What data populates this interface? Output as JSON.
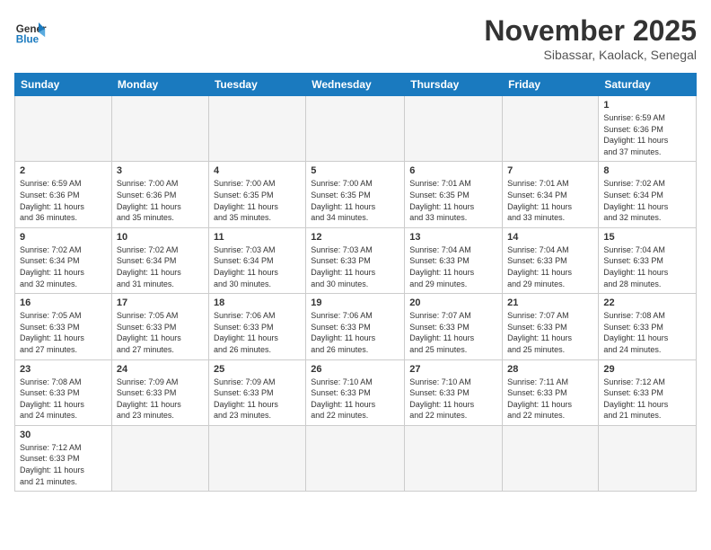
{
  "header": {
    "logo_general": "General",
    "logo_blue": "Blue",
    "month_title": "November 2025",
    "location": "Sibassar, Kaolack, Senegal"
  },
  "days_of_week": [
    "Sunday",
    "Monday",
    "Tuesday",
    "Wednesday",
    "Thursday",
    "Friday",
    "Saturday"
  ],
  "weeks": [
    [
      {
        "day": "",
        "info": ""
      },
      {
        "day": "",
        "info": ""
      },
      {
        "day": "",
        "info": ""
      },
      {
        "day": "",
        "info": ""
      },
      {
        "day": "",
        "info": ""
      },
      {
        "day": "",
        "info": ""
      },
      {
        "day": "1",
        "info": "Sunrise: 6:59 AM\nSunset: 6:36 PM\nDaylight: 11 hours\nand 37 minutes."
      }
    ],
    [
      {
        "day": "2",
        "info": "Sunrise: 6:59 AM\nSunset: 6:36 PM\nDaylight: 11 hours\nand 36 minutes."
      },
      {
        "day": "3",
        "info": "Sunrise: 7:00 AM\nSunset: 6:36 PM\nDaylight: 11 hours\nand 35 minutes."
      },
      {
        "day": "4",
        "info": "Sunrise: 7:00 AM\nSunset: 6:35 PM\nDaylight: 11 hours\nand 35 minutes."
      },
      {
        "day": "5",
        "info": "Sunrise: 7:00 AM\nSunset: 6:35 PM\nDaylight: 11 hours\nand 34 minutes."
      },
      {
        "day": "6",
        "info": "Sunrise: 7:01 AM\nSunset: 6:35 PM\nDaylight: 11 hours\nand 33 minutes."
      },
      {
        "day": "7",
        "info": "Sunrise: 7:01 AM\nSunset: 6:34 PM\nDaylight: 11 hours\nand 33 minutes."
      },
      {
        "day": "8",
        "info": "Sunrise: 7:02 AM\nSunset: 6:34 PM\nDaylight: 11 hours\nand 32 minutes."
      }
    ],
    [
      {
        "day": "9",
        "info": "Sunrise: 7:02 AM\nSunset: 6:34 PM\nDaylight: 11 hours\nand 32 minutes."
      },
      {
        "day": "10",
        "info": "Sunrise: 7:02 AM\nSunset: 6:34 PM\nDaylight: 11 hours\nand 31 minutes."
      },
      {
        "day": "11",
        "info": "Sunrise: 7:03 AM\nSunset: 6:34 PM\nDaylight: 11 hours\nand 30 minutes."
      },
      {
        "day": "12",
        "info": "Sunrise: 7:03 AM\nSunset: 6:33 PM\nDaylight: 11 hours\nand 30 minutes."
      },
      {
        "day": "13",
        "info": "Sunrise: 7:04 AM\nSunset: 6:33 PM\nDaylight: 11 hours\nand 29 minutes."
      },
      {
        "day": "14",
        "info": "Sunrise: 7:04 AM\nSunset: 6:33 PM\nDaylight: 11 hours\nand 29 minutes."
      },
      {
        "day": "15",
        "info": "Sunrise: 7:04 AM\nSunset: 6:33 PM\nDaylight: 11 hours\nand 28 minutes."
      }
    ],
    [
      {
        "day": "16",
        "info": "Sunrise: 7:05 AM\nSunset: 6:33 PM\nDaylight: 11 hours\nand 27 minutes."
      },
      {
        "day": "17",
        "info": "Sunrise: 7:05 AM\nSunset: 6:33 PM\nDaylight: 11 hours\nand 27 minutes."
      },
      {
        "day": "18",
        "info": "Sunrise: 7:06 AM\nSunset: 6:33 PM\nDaylight: 11 hours\nand 26 minutes."
      },
      {
        "day": "19",
        "info": "Sunrise: 7:06 AM\nSunset: 6:33 PM\nDaylight: 11 hours\nand 26 minutes."
      },
      {
        "day": "20",
        "info": "Sunrise: 7:07 AM\nSunset: 6:33 PM\nDaylight: 11 hours\nand 25 minutes."
      },
      {
        "day": "21",
        "info": "Sunrise: 7:07 AM\nSunset: 6:33 PM\nDaylight: 11 hours\nand 25 minutes."
      },
      {
        "day": "22",
        "info": "Sunrise: 7:08 AM\nSunset: 6:33 PM\nDaylight: 11 hours\nand 24 minutes."
      }
    ],
    [
      {
        "day": "23",
        "info": "Sunrise: 7:08 AM\nSunset: 6:33 PM\nDaylight: 11 hours\nand 24 minutes."
      },
      {
        "day": "24",
        "info": "Sunrise: 7:09 AM\nSunset: 6:33 PM\nDaylight: 11 hours\nand 23 minutes."
      },
      {
        "day": "25",
        "info": "Sunrise: 7:09 AM\nSunset: 6:33 PM\nDaylight: 11 hours\nand 23 minutes."
      },
      {
        "day": "26",
        "info": "Sunrise: 7:10 AM\nSunset: 6:33 PM\nDaylight: 11 hours\nand 22 minutes."
      },
      {
        "day": "27",
        "info": "Sunrise: 7:10 AM\nSunset: 6:33 PM\nDaylight: 11 hours\nand 22 minutes."
      },
      {
        "day": "28",
        "info": "Sunrise: 7:11 AM\nSunset: 6:33 PM\nDaylight: 11 hours\nand 22 minutes."
      },
      {
        "day": "29",
        "info": "Sunrise: 7:12 AM\nSunset: 6:33 PM\nDaylight: 11 hours\nand 21 minutes."
      }
    ],
    [
      {
        "day": "30",
        "info": "Sunrise: 7:12 AM\nSunset: 6:33 PM\nDaylight: 11 hours\nand 21 minutes."
      },
      {
        "day": "",
        "info": ""
      },
      {
        "day": "",
        "info": ""
      },
      {
        "day": "",
        "info": ""
      },
      {
        "day": "",
        "info": ""
      },
      {
        "day": "",
        "info": ""
      },
      {
        "day": "",
        "info": ""
      }
    ]
  ]
}
